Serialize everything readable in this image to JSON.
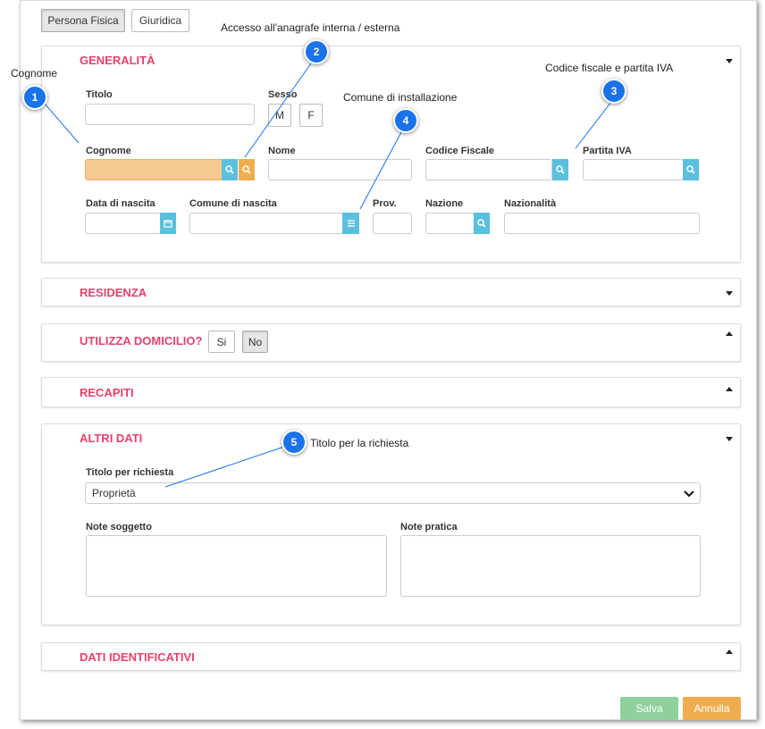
{
  "tabs": {
    "persona_fisica": "Persona Fisica",
    "giuridica": "Giuridica"
  },
  "annotations": {
    "a1": {
      "num": "1",
      "text": "Cognome"
    },
    "a2": {
      "num": "2",
      "text": "Accesso all'anagrafe interna / esterna"
    },
    "a3": {
      "num": "3",
      "text": "Codice fiscale e partita IVA"
    },
    "a4": {
      "num": "4",
      "text": "Comune di installazione"
    },
    "a5": {
      "num": "5",
      "text": "Titolo per la richiesta"
    }
  },
  "generalita": {
    "title": "GENERALITÀ",
    "titolo_label": "Titolo",
    "sesso_label": "Sesso",
    "sesso_m": "M",
    "sesso_f": "F",
    "cognome_label": "Cognome",
    "nome_label": "Nome",
    "codice_fiscale_label": "Codice Fiscale",
    "partita_iva_label": "Partita IVA",
    "data_nascita_label": "Data di nascita",
    "comune_nascita_label": "Comune di nascita",
    "prov_label": "Prov.",
    "nazione_label": "Nazione",
    "nazionalita_label": "Nazionalità"
  },
  "residenza": {
    "title": "RESIDENZA"
  },
  "domicilio": {
    "title": "UTILIZZA DOMICILIO?",
    "si": "Si",
    "no": "No"
  },
  "recapiti": {
    "title": "RECAPITI"
  },
  "altri_dati": {
    "title": "ALTRI DATI",
    "titolo_richiesta_label": "Titolo per richiesta",
    "titolo_richiesta_value": "Proprietà",
    "note_soggetto_label": "Note soggetto",
    "note_pratica_label": "Note pratica"
  },
  "dati_identificativi": {
    "title": "DATI IDENTIFICATIVI"
  },
  "footer": {
    "salva": "Salva",
    "annulla": "Annulla"
  },
  "colors": {
    "accent": "#e8416b",
    "info": "#5bc0de",
    "warning": "#f0ad4e",
    "success": "#8fd19e",
    "annotation": "#1a73e8"
  }
}
